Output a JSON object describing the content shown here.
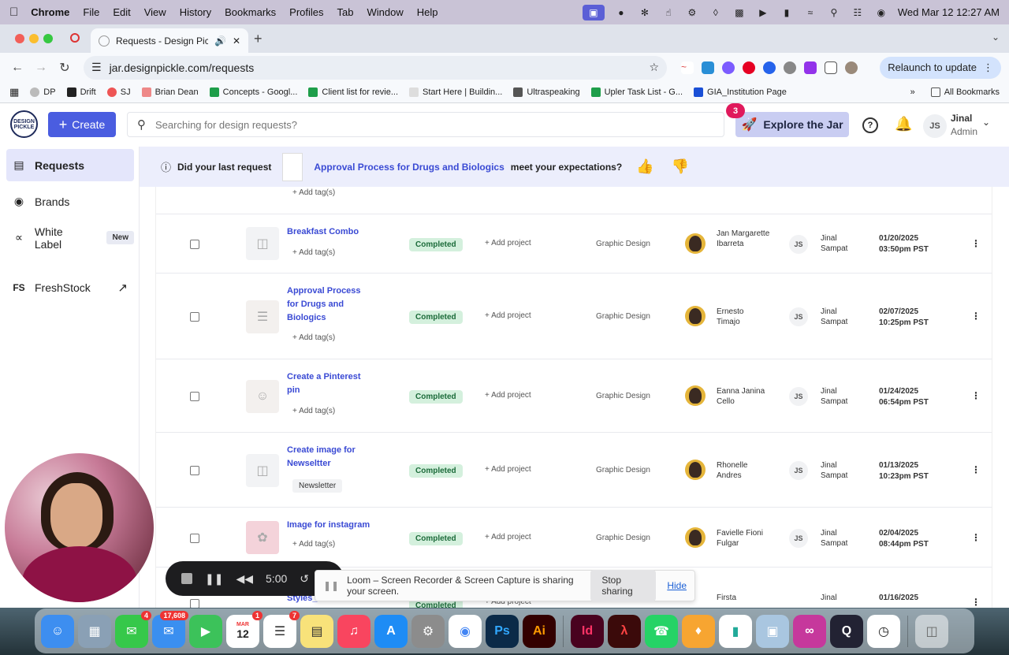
{
  "menubar": {
    "app": "Chrome",
    "items": [
      "File",
      "Edit",
      "View",
      "History",
      "Bookmarks",
      "Profiles",
      "Tab",
      "Window",
      "Help"
    ],
    "clock": "Wed Mar 12  12:27 AM"
  },
  "browser": {
    "tab_title": "Requests - Design Pickle",
    "url": "jar.designpickle.com/requests",
    "relaunch_label": "Relaunch to update",
    "bookmarks": [
      "DP",
      "Drift",
      "SJ",
      "Brian Dean",
      "Concepts - Googl...",
      "Client list for revie...",
      "Start Here | Buildin...",
      "Ultraspeaking",
      "Upler Task List - G...",
      "GIA_Institution Page"
    ],
    "all_bookmarks": "All Bookmarks"
  },
  "header": {
    "logo_text": "DESIGN PICKLE",
    "create_label": "Create",
    "search_placeholder": "Searching for design requests?",
    "notification_count": "3",
    "explore_label": "Explore the Jar",
    "user_initials": "JS",
    "user_name": "Jinal",
    "user_role": "Admin"
  },
  "sidebar": {
    "items": [
      {
        "label": "Requests",
        "icon": "requests-icon"
      },
      {
        "label": "Brands",
        "icon": "palette-icon"
      },
      {
        "label": "White Label",
        "icon": "share-icon",
        "tag": "New"
      },
      {
        "label": "FreshStock",
        "icon": "freshstock-icon"
      }
    ]
  },
  "feedback": {
    "prefix": "Did your last request",
    "request_name": "Approval Process for Drugs and Biologics",
    "suffix": "meet your expectations?"
  },
  "partial_row": {
    "addtag": "+ Add tag(s)"
  },
  "rows": [
    {
      "title": "Breakfast Combo",
      "tag": "+ Add tag(s)",
      "status": "Completed",
      "project": "+ Add project",
      "category": "Graphic Design",
      "designer": "Jan Margarette Ibarreta",
      "owner_initials": "JS",
      "owner": "Jinal Sampat",
      "date": "01/20/2025",
      "time": "03:50pm PST"
    },
    {
      "title": "Approval Process for Drugs and Biologics",
      "tag": "+ Add tag(s)",
      "status": "Completed",
      "project": "+ Add project",
      "category": "Graphic Design",
      "designer": "Ernesto Timajo",
      "owner_initials": "JS",
      "owner": "Jinal Sampat",
      "date": "02/07/2025",
      "time": "10:25pm PST"
    },
    {
      "title": "Create a Pinterest pin",
      "tag": "+ Add tag(s)",
      "status": "Completed",
      "project": "+ Add project",
      "category": "Graphic Design",
      "designer": "Eanna Janina Cello",
      "owner_initials": "JS",
      "owner": "Jinal Sampat",
      "date": "01/24/2025",
      "time": "06:54pm PST"
    },
    {
      "title": "Create image for Newseltter",
      "tag": "Newsletter",
      "status": "Completed",
      "project": "+ Add project",
      "category": "Graphic Design",
      "designer": "Rhonelle Andres",
      "owner_initials": "JS",
      "owner": "Jinal Sampat",
      "date": "01/13/2025",
      "time": "10:23pm PST"
    },
    {
      "title": "Image for instagram",
      "tag": "+ Add tag(s)",
      "status": "Completed",
      "project": "+ Add project",
      "category": "Graphic Design",
      "designer": "Favielle Fioni Fulgar",
      "owner_initials": "JS",
      "owner": "Jinal Sampat",
      "date": "02/04/2025",
      "time": "08:44pm PST"
    },
    {
      "title": "Styles_",
      "tag": "",
      "status": "Completed",
      "project": "+ Add project",
      "category": "Graphic Design",
      "designer": "Firsta",
      "owner_initials": "JS",
      "owner": "Jinal",
      "date": "01/16/2025",
      "time": ""
    }
  ],
  "recorder": {
    "timer": "5:00"
  },
  "sharebar": {
    "message": "Loom – Screen Recorder & Screen Capture is sharing your screen.",
    "stop_label": "Stop sharing",
    "hide_label": "Hide"
  },
  "dock": {
    "calendar_month": "MAR",
    "calendar_day": "12",
    "badges": {
      "messages": "4",
      "mail": "17,608",
      "calendar": "1",
      "reminders": "7"
    }
  }
}
